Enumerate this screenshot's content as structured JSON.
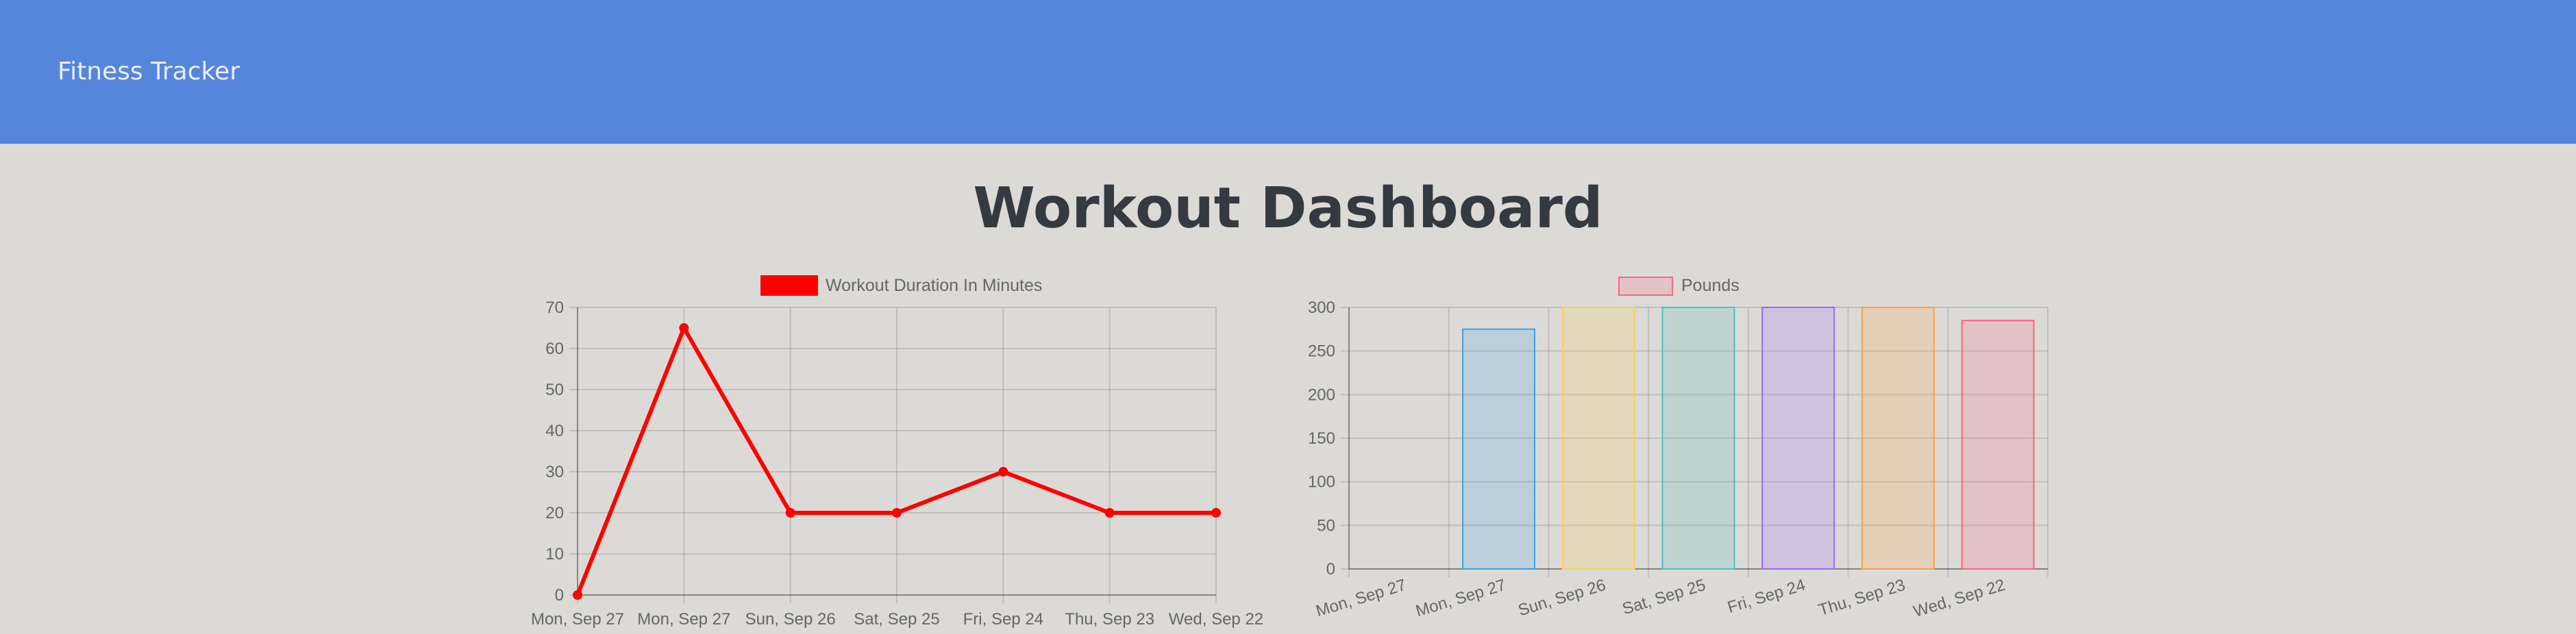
{
  "navbar": {
    "brand": "Fitness Tracker"
  },
  "main": {
    "title": "Workout Dashboard"
  },
  "colors": {
    "navbar": "#5686dc",
    "background": "#dcdad6",
    "line": "#ff0000"
  },
  "chart_data": [
    {
      "type": "line",
      "categories": [
        "Mon, Sep 27",
        "Mon, Sep 27",
        "Sun, Sep 26",
        "Sat, Sep 25",
        "Fri, Sep 24",
        "Thu, Sep 23",
        "Wed, Sep 22"
      ],
      "series": [
        {
          "name": "Workout Duration In Minutes",
          "values": [
            0,
            65,
            20,
            20,
            30,
            20,
            20
          ],
          "color": "#ff0000"
        }
      ],
      "ylim": [
        0,
        70
      ],
      "yticks": [
        0,
        10,
        20,
        30,
        40,
        50,
        60,
        70
      ],
      "legend": "top",
      "grid": true
    },
    {
      "type": "bar",
      "categories": [
        "Mon, Sep 27",
        "Mon, Sep 27",
        "Sun, Sep 26",
        "Sat, Sep 25",
        "Fri, Sep 24",
        "Thu, Sep 23",
        "Wed, Sep 22"
      ],
      "series": [
        {
          "name": "Pounds",
          "values": [
            0,
            275,
            300,
            300,
            300,
            300,
            285
          ]
        }
      ],
      "bar_colors": [
        "#ff6384",
        "#36a2eb",
        "#ffce56",
        "#4bc0c0",
        "#9966ff",
        "#ff9f40",
        "#ff6384"
      ],
      "ylim": [
        0,
        300
      ],
      "yticks": [
        0,
        50,
        100,
        150,
        200,
        250,
        300
      ],
      "legend": "top",
      "grid": true
    }
  ]
}
